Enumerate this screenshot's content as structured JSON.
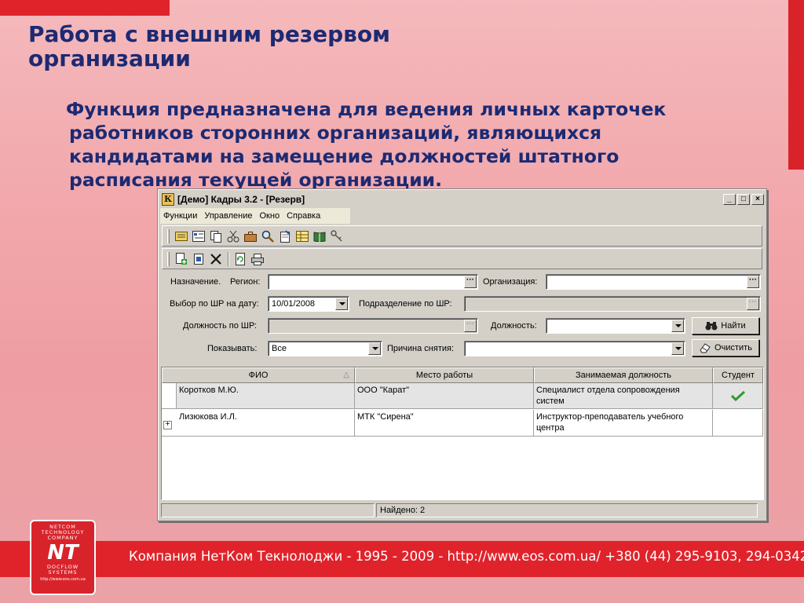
{
  "slide": {
    "title_line1": "Работа с внешним резервом",
    "title_line2": "организации",
    "text_lines": [
      "Функция предназначена для ведения личных карточек",
      "работников сторонних организаций, являющихся",
      "кандидатами на замещение должностей штатного",
      "расписания текущей организации."
    ],
    "footer": "Компания НетКом Текнолоджи - 1995 - 2009 - http://www.eos.com.ua/ +380 (44) 295-9103, 294-0342",
    "logo": {
      "top": "NETCOM TECHNOLOGY COMPANY",
      "mark": "NT",
      "bottom": "DOCFLOW SYSTEMS",
      "url": "http://www.eos.com.ua"
    },
    "accent_red": "#e0232b",
    "title_color": "#1c2a73"
  },
  "window": {
    "title": "[Демо] Кадры 3.2 - [Резерв]",
    "app_icon_letter": "К",
    "controls": {
      "minimize": "_",
      "maximize": "□",
      "close": "×"
    },
    "menu": [
      "Функции",
      "Управление",
      "Окно",
      "Справка"
    ],
    "toolbar1_icons": [
      "card-icon",
      "list-icon",
      "copy-icon",
      "scissors-icon",
      "briefcase-icon",
      "magnifier-icon",
      "notepad-icon",
      "table-icon",
      "book-icon",
      "keys-icon"
    ],
    "toolbar2_icons": [
      "add-document-icon",
      "document-icon",
      "delete-icon",
      "refresh-icon",
      "print-icon"
    ]
  },
  "filters": {
    "purpose_label": "Назначение.",
    "region_label": "Регион:",
    "region_value": "",
    "organization_label": "Организация:",
    "organization_value": "",
    "date_label": "Выбор по ШР на дату:",
    "date_value": "10/01/2008",
    "subdivision_label": "Подразделение по ШР:",
    "subdivision_value": "",
    "position_sr_label": "Должность по ШР:",
    "position_sr_value": "",
    "position_label": "Должность:",
    "position_value": "",
    "find_button": "Найти",
    "show_label": "Показывать:",
    "show_value": "Все",
    "reason_label": "Причина снятия:",
    "reason_value": "",
    "clear_button": "Очистить",
    "dots": "···"
  },
  "grid": {
    "columns": [
      "ФИО",
      "Место работы",
      "Занимаемая должность",
      "Студент"
    ],
    "sort_indicator": "△",
    "rows": [
      {
        "name": "Коротков М.Ю.",
        "workplace": "ООО \"Карат\"",
        "position": "Специалист отдела сопровождения систем",
        "student": true
      },
      {
        "name": "Лизюкова И.Л.",
        "workplace": "МТК \"Сирена\"",
        "position": "Инструктор-преподаватель учебного центра",
        "student": false
      }
    ],
    "expand_symbol": "+"
  },
  "status": {
    "found": "Найдено: 2"
  }
}
